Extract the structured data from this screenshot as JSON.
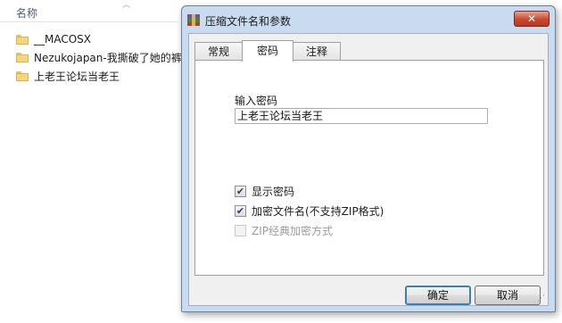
{
  "explorer": {
    "column_header": "名称",
    "files": [
      {
        "name": "__MACOSX",
        "icon": "folder-icon"
      },
      {
        "name": "Nezukojapan-我撕破了她的裤",
        "icon": "folder-icon"
      },
      {
        "name": "上老王论坛当老王",
        "icon": "folder-icon"
      }
    ]
  },
  "dialog": {
    "title": "压缩文件名和参数",
    "close_label": "✕",
    "tabs": [
      "常规",
      "密码",
      "注释"
    ],
    "active_tab": "密码",
    "password_label": "输入密码",
    "password_value": "上老王论坛当老王",
    "options": [
      {
        "label": "显示密码",
        "checked": true,
        "enabled": true
      },
      {
        "label": "加密文件名(不支持ZIP格式)",
        "checked": true,
        "enabled": true
      },
      {
        "label": "ZIP经典加密方式",
        "checked": false,
        "enabled": false
      }
    ],
    "ok_label": "确定",
    "cancel_label": "取消"
  },
  "colors": {
    "dialog_frame": "#c9dbee",
    "close_button": "#c9492f",
    "header_text": "#4c607a"
  }
}
